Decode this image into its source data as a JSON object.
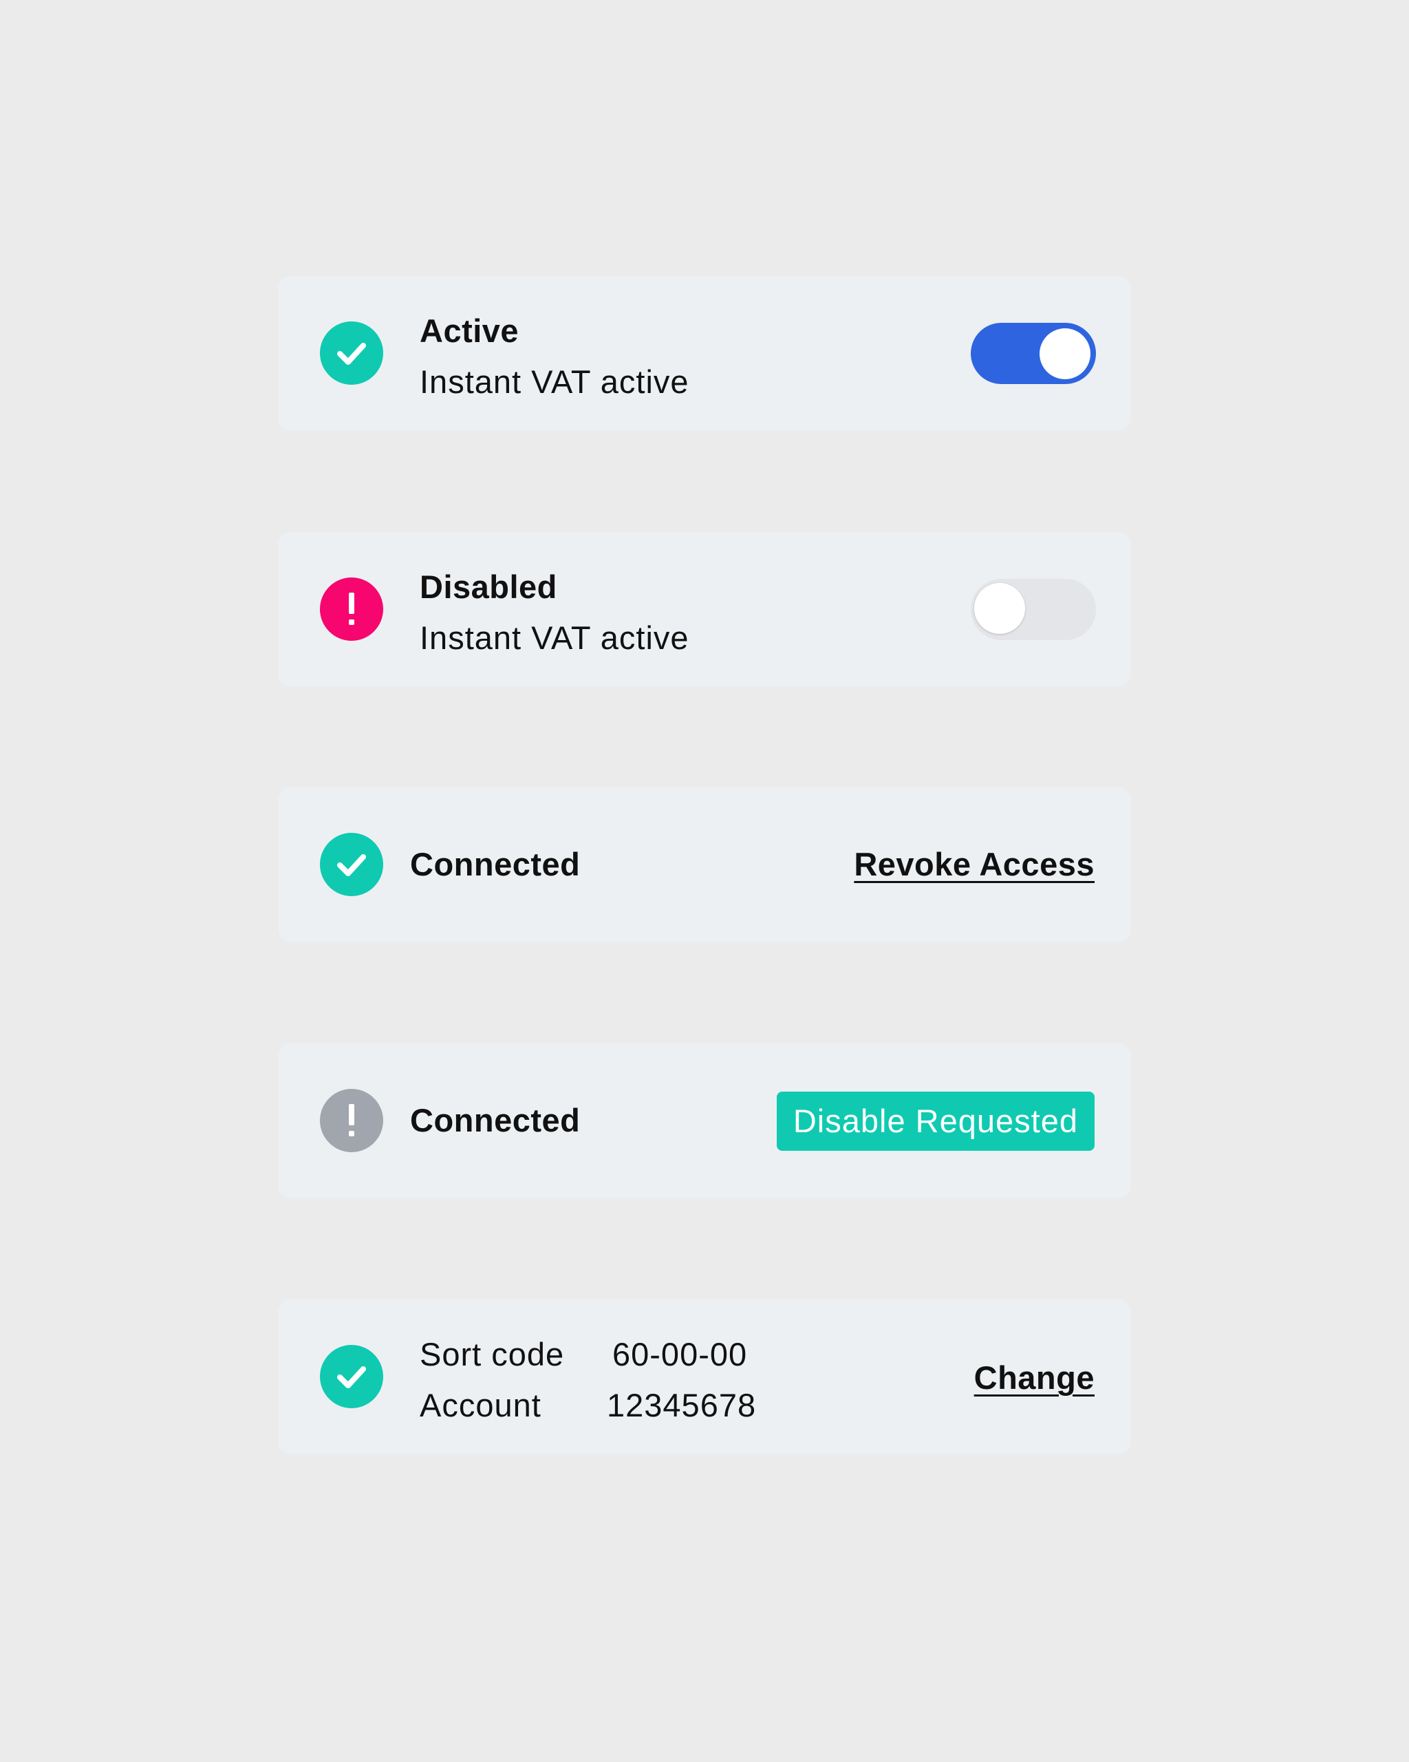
{
  "colors": {
    "background": "#ebebeb",
    "card": "#edf0f2",
    "success": "#0fcab1",
    "error": "#f6066e",
    "neutral": "#a1a5ad",
    "toggle_on": "#2f64e0",
    "toggle_off": "#e3e5e8"
  },
  "cards": [
    {
      "status_icon": "check-icon",
      "title": "Active",
      "subtitle": "Instant VAT active",
      "toggle": {
        "state": "on"
      }
    },
    {
      "status_icon": "exclamation-icon",
      "title": "Disabled",
      "subtitle": "Instant VAT active",
      "toggle": {
        "state": "off"
      }
    },
    {
      "status_icon": "check-icon",
      "title": "Connected",
      "action_link": "Revoke Access"
    },
    {
      "status_icon": "exclamation-icon",
      "title": "Connected",
      "badge": "Disable Requested"
    },
    {
      "status_icon": "check-icon",
      "details": [
        {
          "label": "Sort code",
          "value": "60-00-00"
        },
        {
          "label": "Account",
          "value": "12345678"
        }
      ],
      "action_link": "Change"
    }
  ]
}
